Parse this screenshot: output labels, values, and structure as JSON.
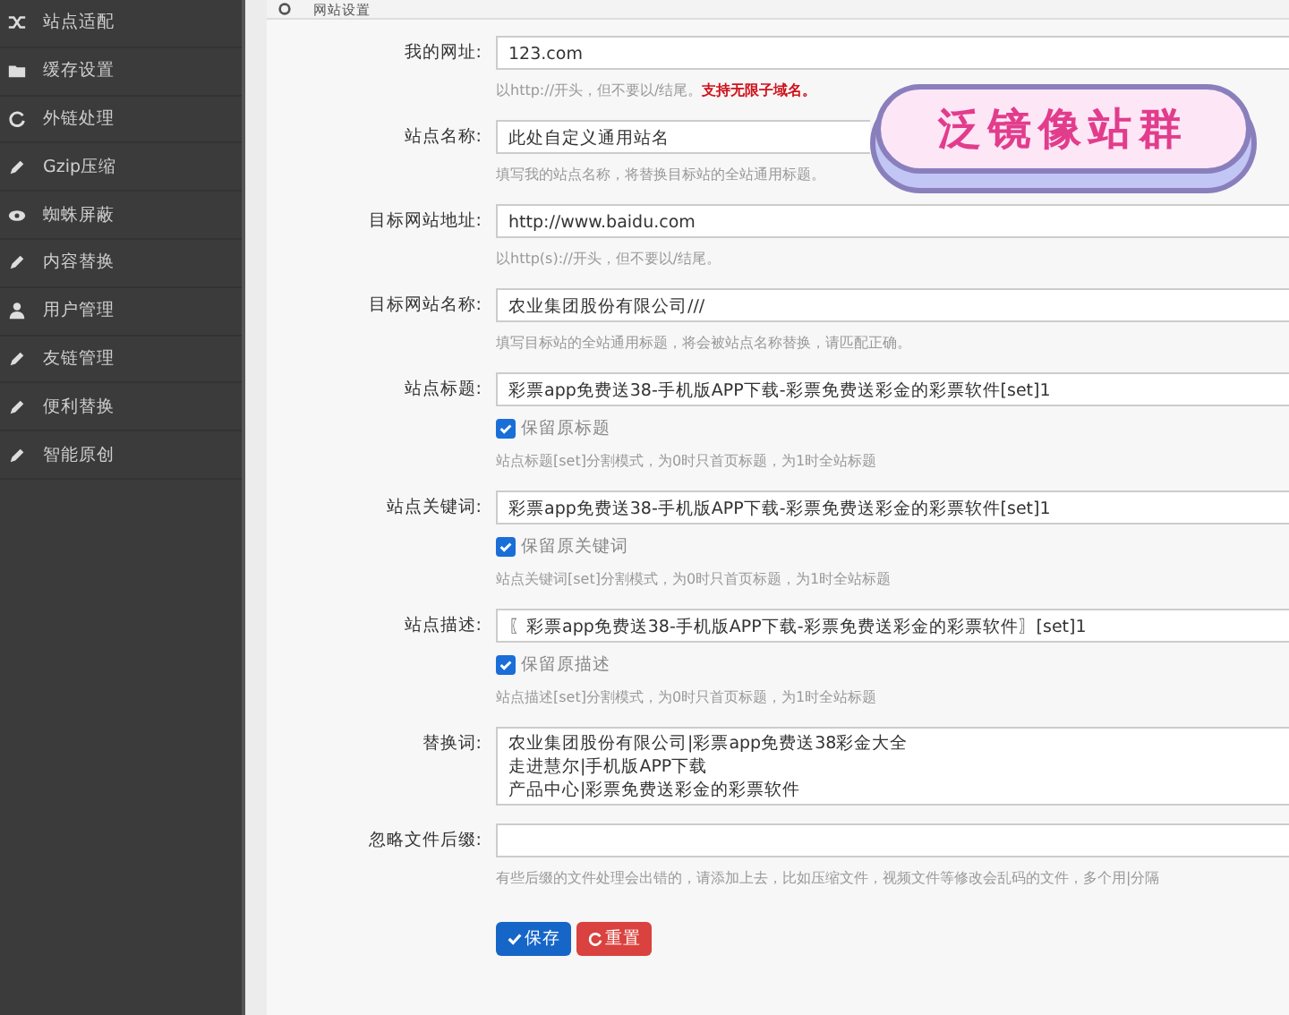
{
  "sidebar": {
    "items": [
      {
        "label": "站点适配",
        "kind": "shuffle"
      },
      {
        "label": "缓存设置",
        "kind": "folder"
      },
      {
        "label": "外链处理",
        "kind": "refresh"
      },
      {
        "label": "Gzip压缩",
        "kind": "pencil"
      },
      {
        "label": "蜘蛛屏蔽",
        "kind": "eye"
      },
      {
        "label": "内容替换",
        "kind": "pencil"
      },
      {
        "label": "用户管理",
        "kind": "user"
      },
      {
        "label": "友链管理",
        "kind": "pencil"
      },
      {
        "label": "便利替换",
        "kind": "pencil"
      },
      {
        "label": "智能原创",
        "kind": "pencil"
      }
    ]
  },
  "header": {
    "title": "网站设置"
  },
  "badge": {
    "text": "泛镜像站群"
  },
  "form": {
    "fields": [
      {
        "kind": "input",
        "label": "我的网址:",
        "value": "123.com",
        "hint": "以http://开头，但不要以/结尾。**支持无限子域名。**"
      },
      {
        "kind": "input",
        "label": "站点名称:",
        "value": "此处自定义通用站名",
        "hint": "填写我的站点名称，将替换目标站的全站通用标题。"
      },
      {
        "kind": "input",
        "label": "目标网站地址:",
        "value": "http://www.baidu.com",
        "hint": "以http(s)://开头，但不要以/结尾。"
      },
      {
        "kind": "input",
        "label": "目标网站名称:",
        "value": "农业集团股份有限公司///",
        "hint": "填写目标站的全站通用标题，将会被站点名称替换，请匹配正确。"
      },
      {
        "kind": "input",
        "label": "站点标题:",
        "value": "彩票app免费送38-手机版APP下载-彩票免费送彩金的彩票软件[set]1",
        "checkbox": {
          "label": "保留原标题",
          "checked": true
        },
        "hint": "站点标题[set]分割模式，为0时只首页标题，为1时全站标题"
      },
      {
        "kind": "input",
        "label": "站点关键词:",
        "value": "彩票app免费送38-手机版APP下载-彩票免费送彩金的彩票软件[set]1",
        "checkbox": {
          "label": "保留原关键词",
          "checked": true
        },
        "hint": "站点关键词[set]分割模式，为0时只首页标题，为1时全站标题"
      },
      {
        "kind": "input",
        "label": "站点描述:",
        "value": "〖彩票app免费送38-手机版APP下载-彩票免费送彩金的彩票软件〗[set]1",
        "checkbox": {
          "label": "保留原描述",
          "checked": true
        },
        "hint": "站点描述[set]分割模式，为0时只首页标题，为1时全站标题"
      },
      {
        "kind": "textarea",
        "label": "替换词:",
        "lines": [
          "农业集团股份有限公司|彩票app免费送38彩金大全",
          "走进慧尔|手机版APP下载",
          "产品中心|彩票免费送彩金的彩票软件"
        ]
      },
      {
        "kind": "input",
        "label": "忽略文件后缀:",
        "hint": "有些后缀的文件处理会出错的，请添加上去，比如压缩文件，视频文件等修改会乱码的文件，多个用|分隔"
      }
    ]
  },
  "buttons": [
    {
      "kind": "primary",
      "label": "保存"
    },
    {
      "kind": "danger",
      "label": "重置"
    }
  ]
}
